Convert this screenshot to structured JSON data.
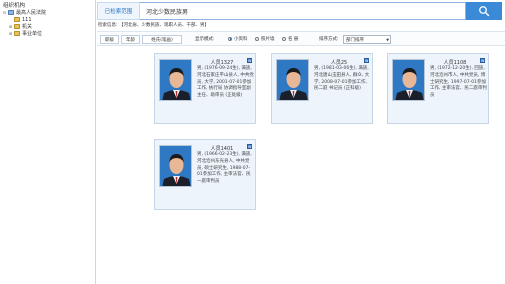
{
  "sidebar": {
    "title": "组织机构",
    "tree": [
      {
        "label": "最高人民法院",
        "toggle": "⊟"
      },
      {
        "label": "111",
        "toggle": ""
      },
      {
        "label": "机关",
        "toggle": "⊞"
      },
      {
        "label": "事业单位",
        "toggle": "⊞"
      }
    ]
  },
  "search": {
    "tab_label": "已检索范围",
    "query": "河北少数民族男",
    "button_icon": "search-icon"
  },
  "condition": {
    "text": "检索信息: 【河北省、少数民族、现职人员、干部、男】"
  },
  "toolbar": {
    "sort_buttons": [
      "职级",
      "年龄",
      "姓氏(笔画)"
    ],
    "display_label": "显示模式:",
    "display_options": [
      "小资料",
      "照片墙",
      "名 册"
    ],
    "display_selected": 0,
    "order_label": "排序方式:",
    "order_value": "部门排序"
  },
  "cards": [
    {
      "name": "人员1327",
      "bio": "男, (1976-09-24生), 满族, 河北石家庄平山县人, 中共党员, 大学, 2001-07-01参加工作, 执行局 协调指导室副主任、助审员 (正处级)"
    },
    {
      "name": "人员25",
      "bio": "男, (1981-03-06生), 满族, 河北唐山玉田县人, 群众, 大学, 2008-07-01参加工作, 民二庭 书记员 (正科级)"
    },
    {
      "name": "人员1108",
      "bio": "男, (1972-12-20生), 回族, 河北沧州市人, 中共党员, 博士研究生, 1997-07-01参加工作, 主审法官、民二庭审判员"
    },
    {
      "name": "人员1401",
      "bio": "男, (1966-02-23生), 满族, 河北沧州东光县人, 中共党员, 硕士研究生, 1988-07-01参加工作, 主审法官、民一庭审判员"
    }
  ],
  "colors": {
    "accent": "#3a8ad7",
    "card_bg": "#eef4fb",
    "photo_bg": "#2f78c4"
  }
}
